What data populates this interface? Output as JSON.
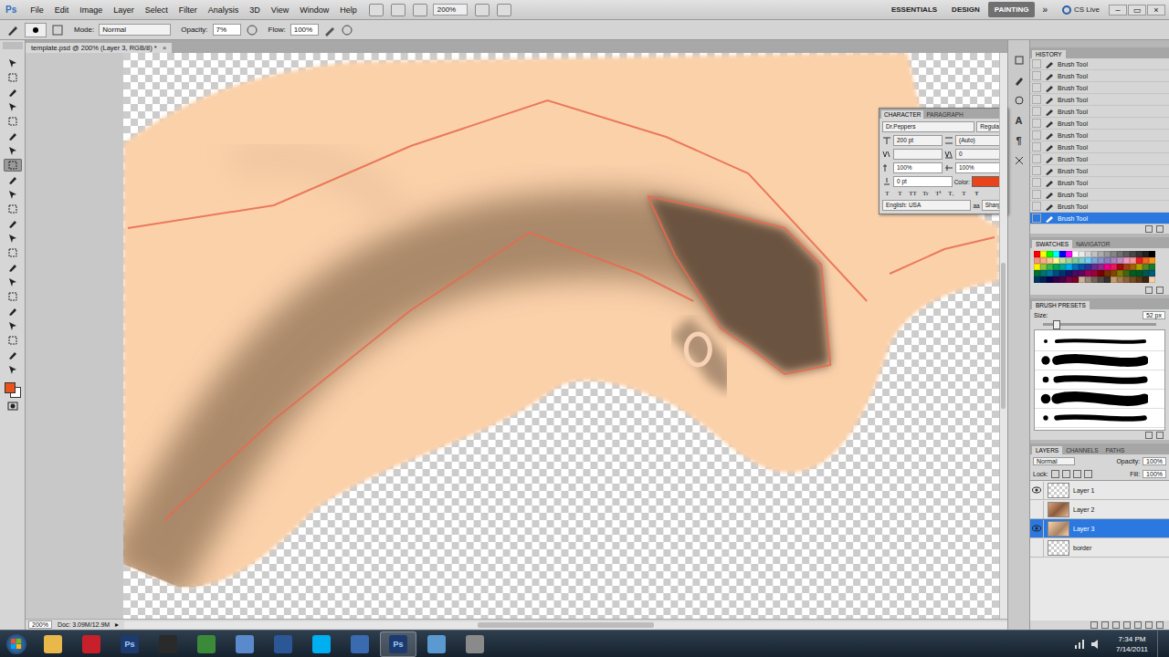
{
  "app": {
    "logo": "Ps",
    "menus": [
      "File",
      "Edit",
      "Image",
      "Layer",
      "Select",
      "Filter",
      "Analysis",
      "3D",
      "View",
      "Window",
      "Help"
    ],
    "zoom": "200%",
    "workspaces": [
      {
        "label": "ESSENTIALS",
        "selected": false
      },
      {
        "label": "DESIGN",
        "selected": false
      },
      {
        "label": "PAINTING",
        "selected": true
      }
    ],
    "more": "»",
    "cs_live": "CS Live",
    "window_controls": [
      "–",
      "▭",
      "×"
    ]
  },
  "options_bar": {
    "mode_label": "Mode:",
    "mode": "Normal",
    "opacity_label": "Opacity:",
    "opacity": "7%",
    "flow_label": "Flow:",
    "flow": "100%"
  },
  "document_tab": {
    "title": "template.psd @ 200% (Layer 3, RGB/8) *",
    "close": "×"
  },
  "tools": [
    {
      "selected": false
    },
    {
      "selected": false
    },
    {
      "selected": false
    },
    {
      "selected": false
    },
    {
      "selected": false
    },
    {
      "selected": false
    },
    {
      "selected": false
    },
    {
      "selected": true
    },
    {
      "selected": false
    },
    {
      "selected": false
    },
    {
      "selected": false
    },
    {
      "selected": false
    },
    {
      "selected": false
    },
    {
      "selected": false
    },
    {
      "selected": false
    },
    {
      "selected": false
    },
    {
      "selected": false
    },
    {
      "selected": false
    },
    {
      "selected": false
    },
    {
      "selected": false
    },
    {
      "selected": false
    },
    {
      "selected": false
    }
  ],
  "colors": {
    "foreground": "#e8521c",
    "background": "#ffffff"
  },
  "character_panel": {
    "tabs": [
      {
        "label": "CHARACTER",
        "selected": true
      },
      {
        "label": "PARAGRAPH",
        "selected": false
      }
    ],
    "font": "Dr.Peppers",
    "style": "Regular",
    "size": "200 pt",
    "leading": "(Auto)",
    "kerning": "",
    "tracking": "0",
    "vertical_scale": "100%",
    "horizontal_scale": "100%",
    "baseline": "0 pt",
    "color_label": "Color:",
    "color": "#e8441c",
    "style_buttons": [
      "T",
      "T",
      "TT",
      "Tr",
      "T¹",
      "T₁",
      "T",
      "Ŧ"
    ],
    "language": "English: USA",
    "antialias_label": "aa",
    "antialias": "Sharp"
  },
  "side_strip": [
    "A",
    "¶"
  ],
  "history": {
    "title": "HISTORY",
    "items": [
      {
        "label": "Brush Tool",
        "selected": false
      },
      {
        "label": "Brush Tool",
        "selected": false
      },
      {
        "label": "Brush Tool",
        "selected": false
      },
      {
        "label": "Brush Tool",
        "selected": false
      },
      {
        "label": "Brush Tool",
        "selected": false
      },
      {
        "label": "Brush Tool",
        "selected": false
      },
      {
        "label": "Brush Tool",
        "selected": false
      },
      {
        "label": "Brush Tool",
        "selected": false
      },
      {
        "label": "Brush Tool",
        "selected": false
      },
      {
        "label": "Brush Tool",
        "selected": false
      },
      {
        "label": "Brush Tool",
        "selected": false
      },
      {
        "label": "Brush Tool",
        "selected": false
      },
      {
        "label": "Brush Tool",
        "selected": false
      },
      {
        "label": "Brush Tool",
        "selected": true
      }
    ]
  },
  "swatches_panel": {
    "tabs": [
      {
        "label": "SWATCHES",
        "selected": true
      },
      {
        "label": "NAVIGATOR",
        "selected": false
      }
    ],
    "colors": [
      "#ff0000",
      "#ffff00",
      "#00ff00",
      "#00ffff",
      "#0000ff",
      "#ff00ff",
      "#ffffff",
      "#ebebeb",
      "#d6d6d6",
      "#c2c2c2",
      "#adadad",
      "#999999",
      "#858585",
      "#707070",
      "#5c5c5c",
      "#474747",
      "#333333",
      "#1f1f1f",
      "#000000",
      "#f7977a",
      "#f9ad81",
      "#fdc68a",
      "#fff79a",
      "#c4df9b",
      "#a3d39c",
      "#82ca9d",
      "#7bcdc8",
      "#6ecff6",
      "#7ea7d8",
      "#8493ca",
      "#8882be",
      "#a187be",
      "#bc8dbf",
      "#f49ac2",
      "#f6989d",
      "#ed1c24",
      "#f26522",
      "#f7941d",
      "#fff200",
      "#8dc73f",
      "#39b54a",
      "#00a651",
      "#00a99d",
      "#00aeef",
      "#0072bc",
      "#0054a6",
      "#2e3192",
      "#662d91",
      "#92278f",
      "#ec008c",
      "#ed145b",
      "#9e0b0f",
      "#a0410d",
      "#a36209",
      "#aba000",
      "#598527",
      "#1a7b30",
      "#007236",
      "#00746b",
      "#0076a3",
      "#004b80",
      "#003471",
      "#1b1464",
      "#440e62",
      "#630460",
      "#9e005d",
      "#9e0039",
      "#790000",
      "#7b2e00",
      "#7d4900",
      "#827b00",
      "#406618",
      "#005e20",
      "#005826",
      "#005952",
      "#005b7f",
      "#003663",
      "#002157",
      "#0d004c",
      "#32004b",
      "#4b0049",
      "#7b0046",
      "#7a0026",
      "#c7b299",
      "#998675",
      "#736357",
      "#534741",
      "#362f2d",
      "#c69c6d",
      "#a67c52",
      "#8c6239",
      "#754c24",
      "#603913",
      "#3c2415",
      "#f5d0a9"
    ]
  },
  "brush_presets": {
    "title": "BRUSH PRESETS",
    "size_label": "Size:",
    "size": "52 px",
    "level": 0.12
  },
  "layers_panel": {
    "tabs": [
      {
        "label": "LAYERS",
        "selected": true
      },
      {
        "label": "CHANNELS",
        "selected": false
      },
      {
        "label": "PATHS",
        "selected": false
      }
    ],
    "blend_mode": "Normal",
    "opacity_label": "Opacity:",
    "opacity": "100%",
    "lock_label": "Lock:",
    "fill_label": "Fill:",
    "fill": "100%",
    "layers": [
      {
        "name": "Layer 1",
        "visible": true,
        "selected": false,
        "kind": "blank"
      },
      {
        "name": "Layer 2",
        "visible": false,
        "selected": false,
        "kind": "painting"
      },
      {
        "name": "Layer 3",
        "visible": true,
        "selected": true,
        "kind": "skin"
      },
      {
        "name": "border",
        "visible": false,
        "selected": false,
        "kind": "blank"
      }
    ]
  },
  "status_bar": {
    "zoom": "200%",
    "doc": "Doc: 3.09M/12.9M",
    "arrow": "▸"
  },
  "taskbar": {
    "apps": [
      {
        "kind": "explorer",
        "label": "",
        "selected": false
      },
      {
        "kind": "acrobat",
        "label": "",
        "selected": false
      },
      {
        "kind": "photoshop",
        "label": "Ps",
        "selected": false
      },
      {
        "kind": "steam",
        "label": "",
        "selected": false
      },
      {
        "kind": "chrome",
        "label": "",
        "selected": false
      },
      {
        "kind": "itunes",
        "label": "",
        "selected": false
      },
      {
        "kind": "word",
        "label": "",
        "selected": false
      },
      {
        "kind": "skype",
        "label": "",
        "selected": false
      },
      {
        "kind": "media",
        "label": "",
        "selected": false
      },
      {
        "kind": "photoshop",
        "label": "Ps",
        "selected": true
      },
      {
        "kind": "network",
        "label": "",
        "selected": false
      },
      {
        "kind": "game",
        "label": "",
        "selected": false
      }
    ],
    "time": "7:34 PM",
    "date": "7/14/2011"
  }
}
